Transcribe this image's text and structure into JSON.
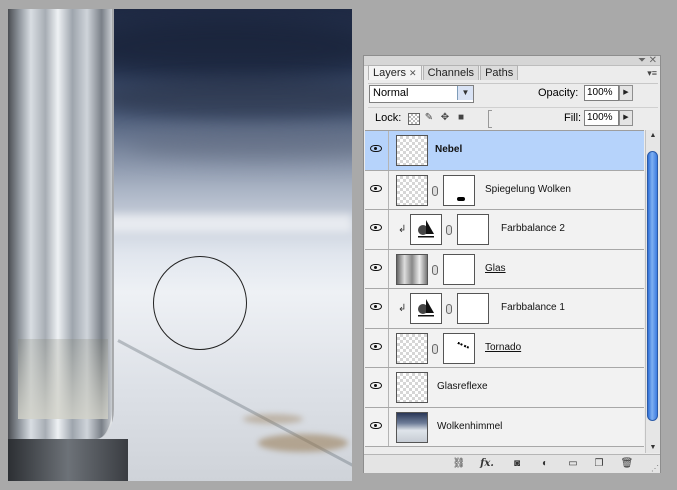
{
  "panel": {
    "tabs": [
      {
        "label": "Layers",
        "close": "✕"
      },
      {
        "label": "Channels"
      },
      {
        "label": "Paths"
      }
    ],
    "blend_mode": "Normal",
    "opacity_label": "Opacity:",
    "opacity_value": "100%",
    "lock_label": "Lock:",
    "fill_label": "Fill:",
    "fill_value": "100%",
    "layers": [
      {
        "name": "Nebel",
        "selected": true
      },
      {
        "name": "Spiegelung Wolken"
      },
      {
        "name": "Farbbalance 2"
      },
      {
        "name": "Glas"
      },
      {
        "name": "Farbbalance 1"
      },
      {
        "name": "Tornado"
      },
      {
        "name": "Glasreflexe"
      },
      {
        "name": "Wolkenhimmel"
      }
    ],
    "bottom_icons": [
      "link-icon",
      "fx-icon",
      "mask-icon",
      "adjustment-icon",
      "folder-icon",
      "new-layer-icon",
      "trash-icon"
    ],
    "fx_label": "fx."
  }
}
